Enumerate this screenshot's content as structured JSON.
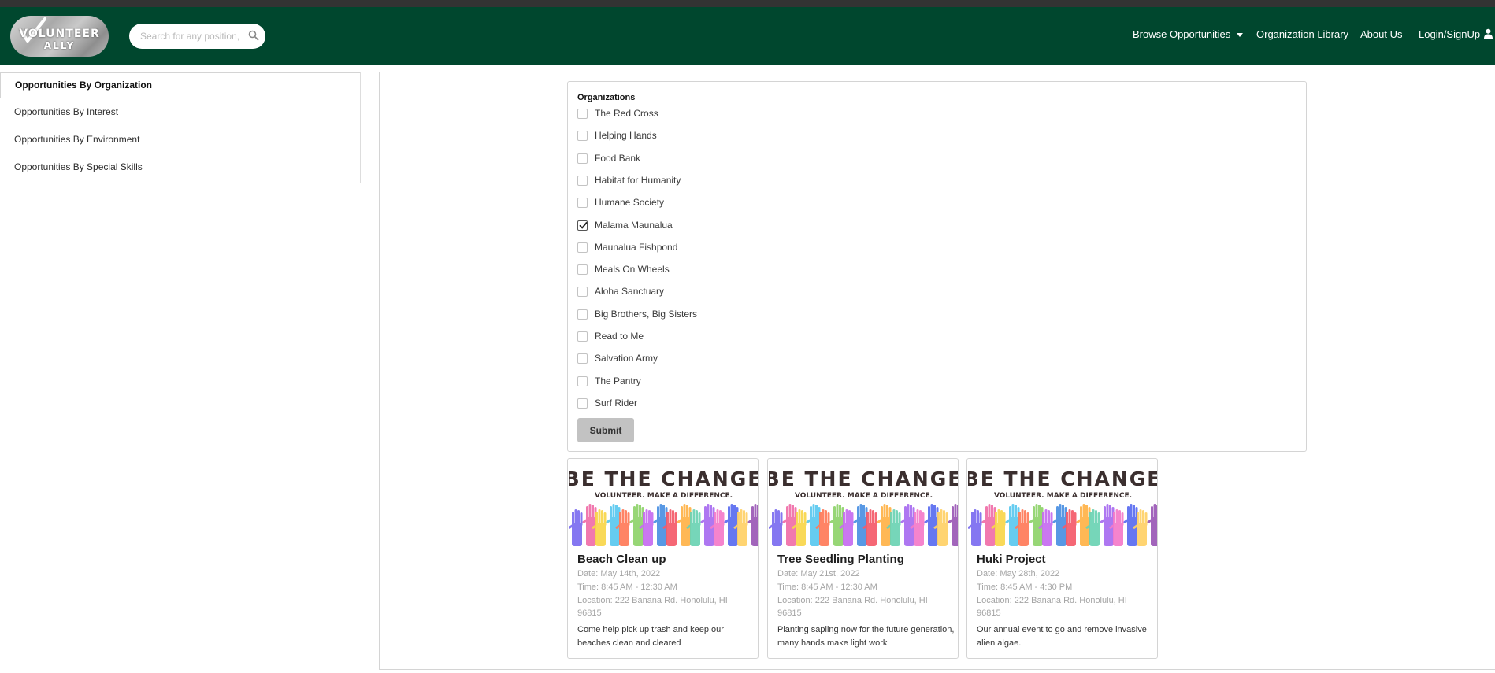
{
  "header": {
    "logo_line1": "VOLUNTEER",
    "logo_line2": "ALLY",
    "search_placeholder": "Search for any position, location",
    "nav": [
      {
        "label": "Browse Opportunities",
        "has_dropdown": true
      },
      {
        "label": "Organization Library"
      },
      {
        "label": "About Us"
      },
      {
        "label": "Login/SignUp",
        "icon": "user-icon"
      }
    ],
    "colors": {
      "brand_green": "#00472e"
    }
  },
  "sidebar": {
    "items": [
      {
        "label": "Opportunities By Organization",
        "active": true
      },
      {
        "label": "Opportunities By Interest"
      },
      {
        "label": "Opportunities By Environment"
      },
      {
        "label": "Opportunities By Special Skills"
      }
    ]
  },
  "filter": {
    "title": "Organizations",
    "options": [
      {
        "label": "The Red Cross",
        "checked": false
      },
      {
        "label": "Helping Hands",
        "checked": false
      },
      {
        "label": "Food Bank",
        "checked": false
      },
      {
        "label": "Habitat for Humanity",
        "checked": false
      },
      {
        "label": "Humane Society",
        "checked": false
      },
      {
        "label": "Malama Maunalua",
        "checked": true
      },
      {
        "label": "Maunalua Fishpond",
        "checked": false
      },
      {
        "label": "Meals On Wheels",
        "checked": false
      },
      {
        "label": "Aloha Sanctuary",
        "checked": false
      },
      {
        "label": "Big Brothers, Big Sisters",
        "checked": false
      },
      {
        "label": "Read to Me",
        "checked": false
      },
      {
        "label": "Salvation Army",
        "checked": false
      },
      {
        "label": "The Pantry",
        "checked": false
      },
      {
        "label": "Surf Rider",
        "checked": false
      }
    ],
    "submit_label": "Submit"
  },
  "banner": {
    "headline": "BE THE CHANGE",
    "tagline": "VOLUNTEER. MAKE A DIFFERENCE."
  },
  "cards": [
    {
      "title": "Beach Clean up",
      "date": "Date: May 14th, 2022",
      "time": "Time: 8:45 AM - 12:30 AM",
      "location": "Location: 222 Banana Rd. Honolulu, HI 96815",
      "description": "Come help pick up trash and keep our beaches clean and cleared"
    },
    {
      "title": "Tree Seedling Planting",
      "date": "Date: May 21st, 2022",
      "time": "Time: 8:45 AM - 12:30 AM",
      "location": "Location: 222 Banana Rd. Honolulu, HI 96815",
      "description": "Planting sapling now for the future generation, many hands make light work"
    },
    {
      "title": "Huki Project",
      "date": "Date: May 28th, 2022",
      "time": "Time: 8:45 AM - 4:30 PM",
      "location": "Location: 222 Banana Rd. Honolulu, HI 96815",
      "description": "Our annual event to go and remove invasive alien algae."
    }
  ]
}
